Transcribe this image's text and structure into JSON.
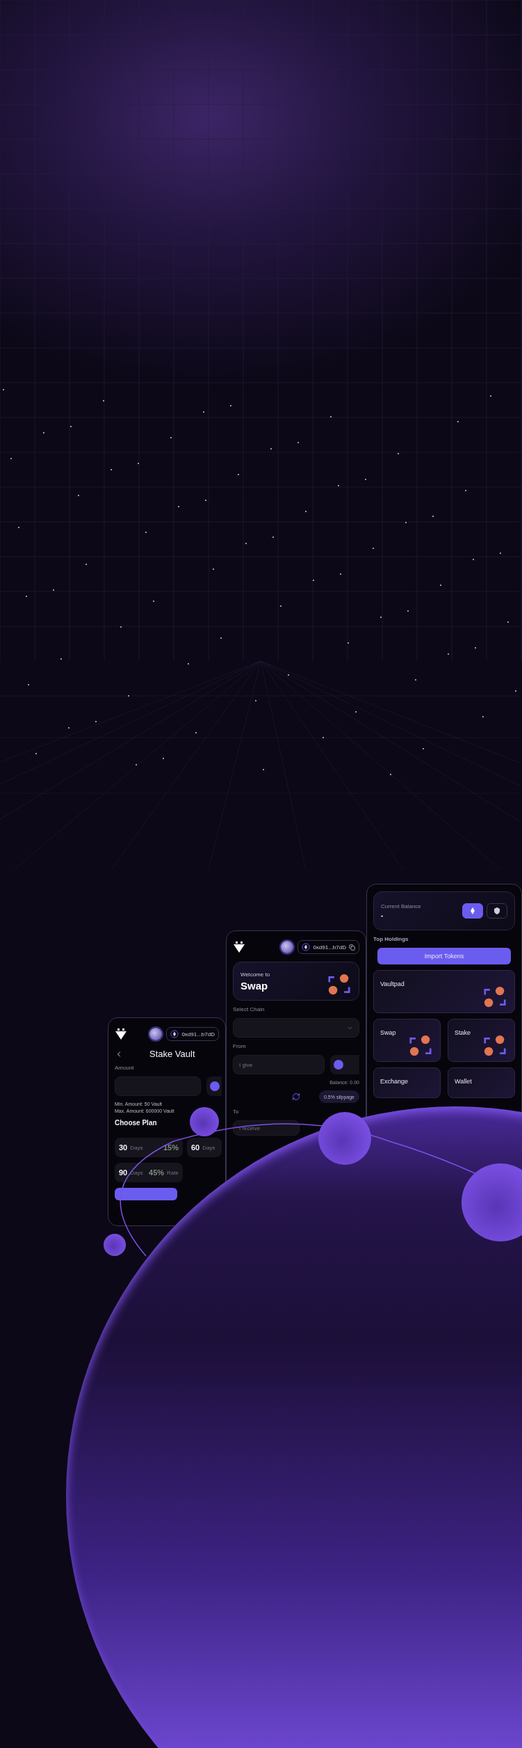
{
  "stake_card": {
    "wallet_address": "0xd91...b7dD",
    "title": "Stake Vault",
    "amount_label": "Amount",
    "min_amount": "Min. Amount: 50 Vault",
    "max_amount": "Max. Amount: 600000 Vault",
    "plans_heading": "Choose Plan",
    "plans": [
      {
        "days": "30",
        "days_label": "Days",
        "rate": "15%"
      },
      {
        "days": "60",
        "days_label": "Days"
      },
      {
        "days": "90",
        "days_label": "Days",
        "rate": "45%",
        "rate_label": "Rate"
      }
    ]
  },
  "swap_card": {
    "wallet_address": "0xd91...b7dD",
    "welcome": "Welcome to",
    "title": "Swap",
    "chain_label": "Select Chain",
    "from_label": "From",
    "give_placeholder": "I give",
    "balance": "Balance: 0.00",
    "slippage": "0.5% slippage",
    "to_label": "To",
    "receive_placeholder": "I receive"
  },
  "wallet_card": {
    "balance_label": "Current Balance",
    "balance_value": "-",
    "currency_buttons": [
      {
        "kind": "eth",
        "selected": true
      },
      {
        "kind": "vault",
        "selected": false
      }
    ],
    "holdings_heading": "Top Holdings",
    "import_button": "Import Tokens",
    "tiles": [
      {
        "label": "Vaultpad",
        "kind": "wide"
      },
      {
        "label": "Swap",
        "kind": "swap"
      },
      {
        "label": "Stake",
        "kind": "stake"
      },
      {
        "label": "Exchange",
        "kind": "exchange"
      },
      {
        "label": "Wallet",
        "kind": "wallet"
      }
    ]
  }
}
